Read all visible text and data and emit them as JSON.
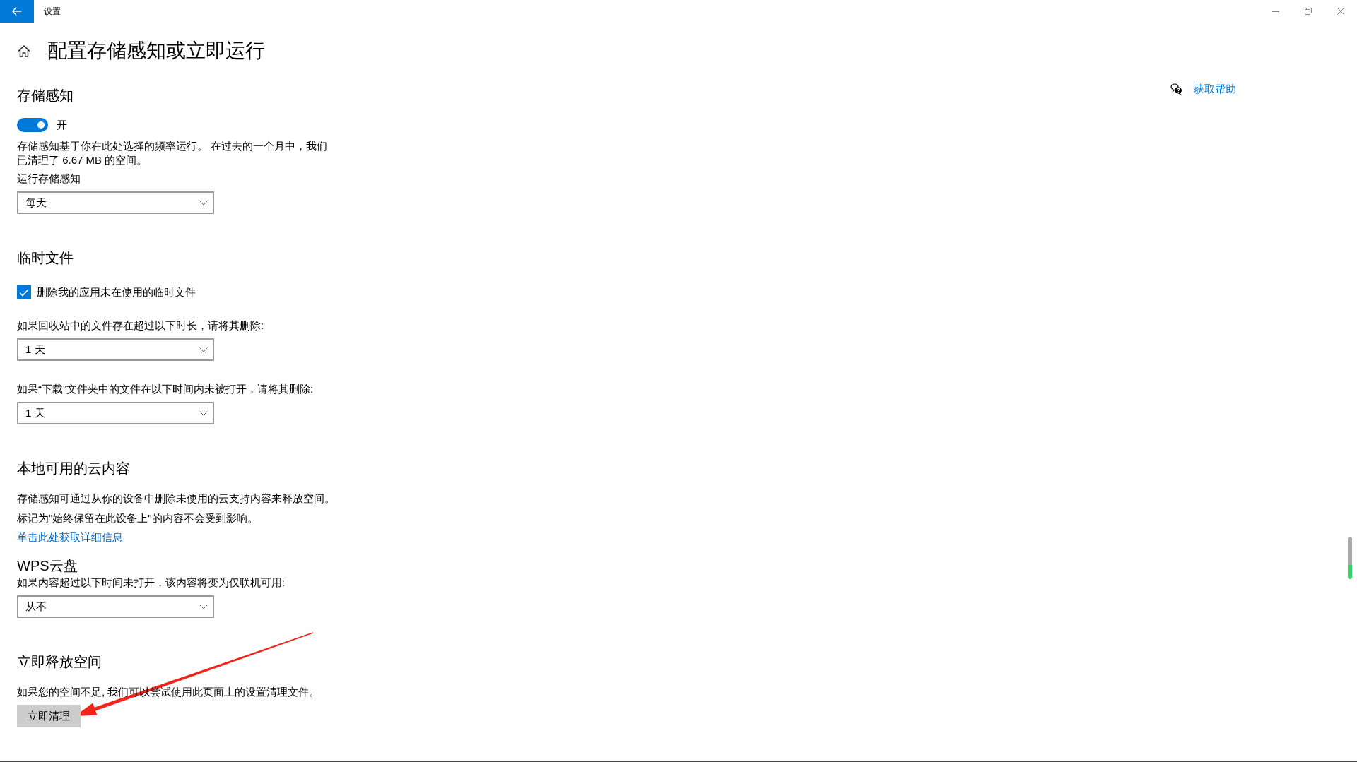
{
  "window": {
    "title": "设置"
  },
  "page": {
    "title": "配置存储感知或立即运行",
    "help_link": "获取帮助"
  },
  "sections": [
    {
      "heading": "存储感知",
      "items": [
        {
          "kind": "toggle",
          "on": true,
          "label": "开"
        },
        {
          "kind": "text",
          "text": "存储感知基于你在此处选择的频率运行。 在过去的一个月中，我们已清理了 6.67 MB 的空间。"
        },
        {
          "kind": "dropdown",
          "label": "运行存储感知",
          "value": "每天"
        }
      ]
    },
    {
      "heading": "临时文件",
      "items": [
        {
          "kind": "checkbox",
          "checked": true,
          "label": "删除我的应用未在使用的临时文件"
        },
        {
          "kind": "dropdown",
          "label": "如果回收站中的文件存在超过以下时长，请将其删除:",
          "value": "1 天"
        },
        {
          "kind": "dropdown",
          "label": "如果“下载”文件夹中的文件在以下时间内未被打开，请将其删除:",
          "value": "1 天"
        }
      ]
    },
    {
      "heading": "本地可用的云内容",
      "items": [
        {
          "kind": "text",
          "text": "存储感知可通过从你的设备中删除未使用的云支持内容来释放空间。"
        },
        {
          "kind": "text",
          "text": "标记为\"始终保留在此设备上\"的内容不会受到影响。"
        },
        {
          "kind": "link",
          "text": "单击此处获取详细信息"
        },
        {
          "kind": "subheading",
          "text": "WPS云盘"
        },
        {
          "kind": "dropdown",
          "label": "如果内容超过以下时间未打开，该内容将变为仅联机可用:",
          "value": "从不"
        }
      ]
    },
    {
      "heading": "立即释放空间",
      "items": [
        {
          "kind": "text",
          "text": "如果您的空间不足, 我们可以尝试使用此页面上的设置清理文件。"
        },
        {
          "kind": "button",
          "label": "立即清理"
        }
      ]
    }
  ]
}
